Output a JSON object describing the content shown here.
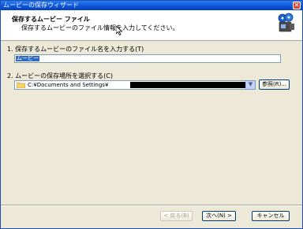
{
  "window": {
    "title": "ムービーの保存ウィザード",
    "close_glyph": "✕"
  },
  "header": {
    "title": "保存するムービー ファイル",
    "subtitle": "保存するムービーのファイル情報を入力してください。"
  },
  "filename": {
    "label": "1. 保存するムービーのファイル名を入力する(T)",
    "value": "ムービー"
  },
  "location": {
    "label": "2. ムービーの保存場所を選択する(C)",
    "value": "C:¥Documents and Settings¥"
  },
  "buttons": {
    "browse": "参照(R)...",
    "back": "< 戻る(B)",
    "next": "次へ(N) >",
    "cancel": "キャンセル"
  },
  "colors": {
    "titlebar": "#0b52d8",
    "selection": "#316ac5"
  }
}
